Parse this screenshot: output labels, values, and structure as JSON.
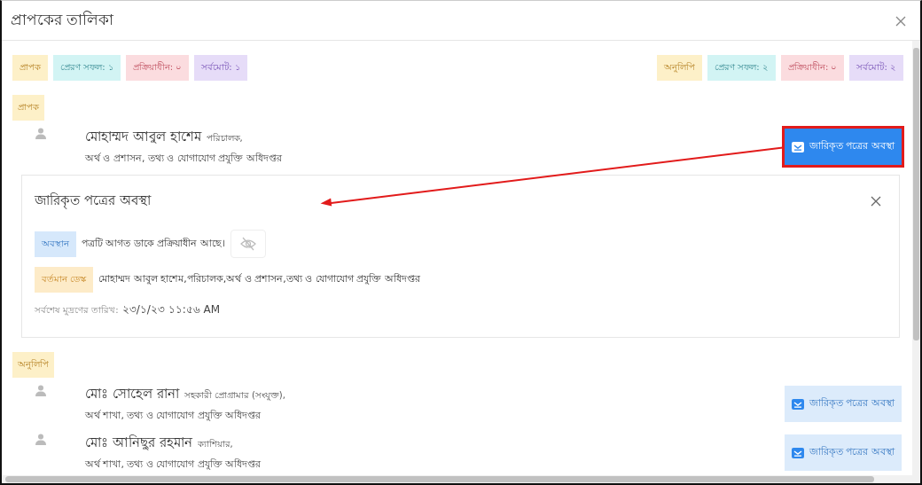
{
  "window": {
    "title": "প্রাপকের তালিকা"
  },
  "summary": {
    "left": [
      {
        "label": "প্রাপক",
        "kind": "type"
      },
      {
        "label": "প্রেরণ সফল: ১",
        "kind": "success"
      },
      {
        "label": "প্রক্রিয়াধীন: ০",
        "kind": "pending"
      },
      {
        "label": "সর্বমোট: ১",
        "kind": "total"
      }
    ],
    "right": [
      {
        "label": "অনুলিপি",
        "kind": "type"
      },
      {
        "label": "প্রেরণ সফল: ২",
        "kind": "success"
      },
      {
        "label": "প্রক্রিয়াধীন: ০",
        "kind": "pending"
      },
      {
        "label": "সর্বমোট: ২",
        "kind": "total"
      }
    ]
  },
  "sections": [
    {
      "label": "প্রাপক",
      "recipients": [
        {
          "name": "মোহাম্মদ আবুল হাশেম",
          "designation": "পরিচালক,",
          "office": "অর্থ ও প্রশাসন, তথ্য ও যোগাযোগ প্রযুক্তি অধিদপ্তর",
          "button": "জারিকৃত পত্রের অবস্থা",
          "selected": true,
          "highlighted": true,
          "status_panel": {
            "title": "জারিকৃত পত্রের অবস্থা",
            "rows": [
              {
                "kind": "location",
                "label": "অবস্থান",
                "text": "পত্রটি আগত ডাকে প্রক্রিয়াধীন আছে।"
              },
              {
                "kind": "desk",
                "label": "বর্তমান ডেস্ক",
                "text": "মোহাম্মদ আবুল হাশেম,পরিচালক,অর্থ ও প্রশাসন,তথ্য ও যোগাযোগ প্রযুক্তি অধিদপ্তর"
              }
            ],
            "last_print_label": "সর্বশেষ মুদ্রণের তারিখ:",
            "last_print_value": "২৩/১/২৩ ১১:৫৬ AM"
          }
        }
      ]
    },
    {
      "label": "অনুলিপি",
      "recipients": [
        {
          "name": "মোঃ সোহেল রানা",
          "designation": "সহকারী প্রোগ্রামার (সংযুক্ত),",
          "office": "অর্থ শাখা, তথ্য ও যোগাযোগ প্রযুক্তি অধিদপ্তর",
          "button": "জারিকৃত পত্রের অবস্থা",
          "selected": false,
          "highlighted": false
        },
        {
          "name": "মোঃ আনিছুর রহমান",
          "designation": "ক্যাশিয়ার,",
          "office": "অর্থ শাখা, তথ্য ও যোগাযোগ প্রযুক্তি অধিদপ্তর",
          "button": "জারিকৃত পত্রের অবস্থা",
          "selected": false,
          "highlighted": false
        }
      ]
    }
  ]
}
